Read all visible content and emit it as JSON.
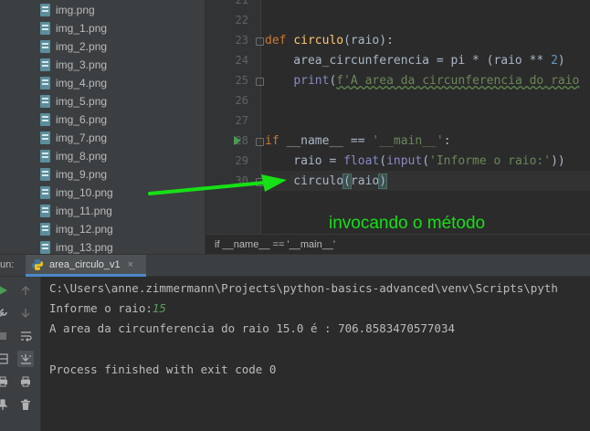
{
  "project_tree": {
    "files": [
      "img.png",
      "img_1.png",
      "img_2.png",
      "img_3.png",
      "img_4.png",
      "img_5.png",
      "img_6.png",
      "img_7.png",
      "img_8.png",
      "img_9.png",
      "img_10.png",
      "img_11.png",
      "img_12.png",
      "img_13.png"
    ]
  },
  "editor": {
    "line_numbers": [
      "21",
      "22",
      "23",
      "24",
      "25",
      "26",
      "27",
      "28",
      "29",
      "30"
    ],
    "code": {
      "l23_def": "def ",
      "l23_name": "circulo",
      "l23_rest": "(raio):",
      "l24_a": "    area_circunferencia = pi * (raio ** ",
      "l24_b": "2",
      "l24_c": ")",
      "l25_a": "    ",
      "l25_print": "print",
      "l25_b": "(",
      "l25_str": "f'A area da circunferencia do raio",
      "l28_if": "if ",
      "l28_a": "__name__ == ",
      "l28_str": "'__main__'",
      "l28_b": ":",
      "l29_a": "    raio = ",
      "l29_float": "float",
      "l29_b": "(",
      "l29_input": "input",
      "l29_c": "(",
      "l29_str": "'Informe o raio:'",
      "l29_d": "))",
      "l30_a": "    circulo",
      "l30_b": "(",
      "l30_c": "raio",
      "l30_d": ")"
    },
    "annotation": "invocando o método",
    "breadcrumb": "if __name__ == '__main__'"
  },
  "run_panel": {
    "label": "un:",
    "tab_label": "area_circulo_v1",
    "tab_close": "×",
    "output": {
      "path": "C:\\Users\\anne.zimmermann\\Projects\\python-basics-advanced\\venv\\Scripts\\pyth",
      "prompt": "Informe o raio:",
      "input_value": "15",
      "result": "A area da circunferencia do raio 15.0 é : 706.8583470577034",
      "exit": "Process finished with exit code 0"
    }
  },
  "colors": {
    "annotation_arrow": "#16e016",
    "keyword": "#cc7832",
    "function_name": "#ffc66d",
    "string": "#6a8759"
  }
}
